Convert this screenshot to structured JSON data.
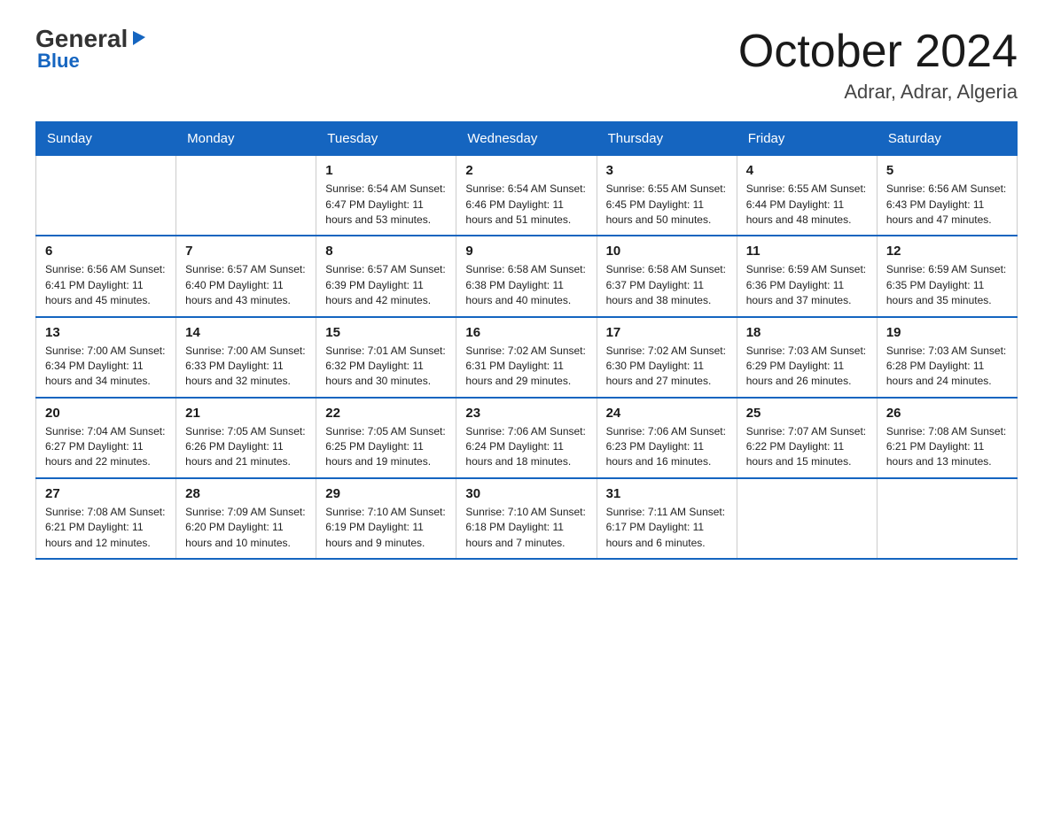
{
  "logo": {
    "general": "General",
    "triangle": "▶",
    "blue": "Blue"
  },
  "header": {
    "month": "October 2024",
    "location": "Adrar, Adrar, Algeria"
  },
  "weekdays": [
    "Sunday",
    "Monday",
    "Tuesday",
    "Wednesday",
    "Thursday",
    "Friday",
    "Saturday"
  ],
  "weeks": [
    [
      {
        "day": "",
        "info": ""
      },
      {
        "day": "",
        "info": ""
      },
      {
        "day": "1",
        "info": "Sunrise: 6:54 AM\nSunset: 6:47 PM\nDaylight: 11 hours\nand 53 minutes."
      },
      {
        "day": "2",
        "info": "Sunrise: 6:54 AM\nSunset: 6:46 PM\nDaylight: 11 hours\nand 51 minutes."
      },
      {
        "day": "3",
        "info": "Sunrise: 6:55 AM\nSunset: 6:45 PM\nDaylight: 11 hours\nand 50 minutes."
      },
      {
        "day": "4",
        "info": "Sunrise: 6:55 AM\nSunset: 6:44 PM\nDaylight: 11 hours\nand 48 minutes."
      },
      {
        "day": "5",
        "info": "Sunrise: 6:56 AM\nSunset: 6:43 PM\nDaylight: 11 hours\nand 47 minutes."
      }
    ],
    [
      {
        "day": "6",
        "info": "Sunrise: 6:56 AM\nSunset: 6:41 PM\nDaylight: 11 hours\nand 45 minutes."
      },
      {
        "day": "7",
        "info": "Sunrise: 6:57 AM\nSunset: 6:40 PM\nDaylight: 11 hours\nand 43 minutes."
      },
      {
        "day": "8",
        "info": "Sunrise: 6:57 AM\nSunset: 6:39 PM\nDaylight: 11 hours\nand 42 minutes."
      },
      {
        "day": "9",
        "info": "Sunrise: 6:58 AM\nSunset: 6:38 PM\nDaylight: 11 hours\nand 40 minutes."
      },
      {
        "day": "10",
        "info": "Sunrise: 6:58 AM\nSunset: 6:37 PM\nDaylight: 11 hours\nand 38 minutes."
      },
      {
        "day": "11",
        "info": "Sunrise: 6:59 AM\nSunset: 6:36 PM\nDaylight: 11 hours\nand 37 minutes."
      },
      {
        "day": "12",
        "info": "Sunrise: 6:59 AM\nSunset: 6:35 PM\nDaylight: 11 hours\nand 35 minutes."
      }
    ],
    [
      {
        "day": "13",
        "info": "Sunrise: 7:00 AM\nSunset: 6:34 PM\nDaylight: 11 hours\nand 34 minutes."
      },
      {
        "day": "14",
        "info": "Sunrise: 7:00 AM\nSunset: 6:33 PM\nDaylight: 11 hours\nand 32 minutes."
      },
      {
        "day": "15",
        "info": "Sunrise: 7:01 AM\nSunset: 6:32 PM\nDaylight: 11 hours\nand 30 minutes."
      },
      {
        "day": "16",
        "info": "Sunrise: 7:02 AM\nSunset: 6:31 PM\nDaylight: 11 hours\nand 29 minutes."
      },
      {
        "day": "17",
        "info": "Sunrise: 7:02 AM\nSunset: 6:30 PM\nDaylight: 11 hours\nand 27 minutes."
      },
      {
        "day": "18",
        "info": "Sunrise: 7:03 AM\nSunset: 6:29 PM\nDaylight: 11 hours\nand 26 minutes."
      },
      {
        "day": "19",
        "info": "Sunrise: 7:03 AM\nSunset: 6:28 PM\nDaylight: 11 hours\nand 24 minutes."
      }
    ],
    [
      {
        "day": "20",
        "info": "Sunrise: 7:04 AM\nSunset: 6:27 PM\nDaylight: 11 hours\nand 22 minutes."
      },
      {
        "day": "21",
        "info": "Sunrise: 7:05 AM\nSunset: 6:26 PM\nDaylight: 11 hours\nand 21 minutes."
      },
      {
        "day": "22",
        "info": "Sunrise: 7:05 AM\nSunset: 6:25 PM\nDaylight: 11 hours\nand 19 minutes."
      },
      {
        "day": "23",
        "info": "Sunrise: 7:06 AM\nSunset: 6:24 PM\nDaylight: 11 hours\nand 18 minutes."
      },
      {
        "day": "24",
        "info": "Sunrise: 7:06 AM\nSunset: 6:23 PM\nDaylight: 11 hours\nand 16 minutes."
      },
      {
        "day": "25",
        "info": "Sunrise: 7:07 AM\nSunset: 6:22 PM\nDaylight: 11 hours\nand 15 minutes."
      },
      {
        "day": "26",
        "info": "Sunrise: 7:08 AM\nSunset: 6:21 PM\nDaylight: 11 hours\nand 13 minutes."
      }
    ],
    [
      {
        "day": "27",
        "info": "Sunrise: 7:08 AM\nSunset: 6:21 PM\nDaylight: 11 hours\nand 12 minutes."
      },
      {
        "day": "28",
        "info": "Sunrise: 7:09 AM\nSunset: 6:20 PM\nDaylight: 11 hours\nand 10 minutes."
      },
      {
        "day": "29",
        "info": "Sunrise: 7:10 AM\nSunset: 6:19 PM\nDaylight: 11 hours\nand 9 minutes."
      },
      {
        "day": "30",
        "info": "Sunrise: 7:10 AM\nSunset: 6:18 PM\nDaylight: 11 hours\nand 7 minutes."
      },
      {
        "day": "31",
        "info": "Sunrise: 7:11 AM\nSunset: 6:17 PM\nDaylight: 11 hours\nand 6 minutes."
      },
      {
        "day": "",
        "info": ""
      },
      {
        "day": "",
        "info": ""
      }
    ]
  ]
}
